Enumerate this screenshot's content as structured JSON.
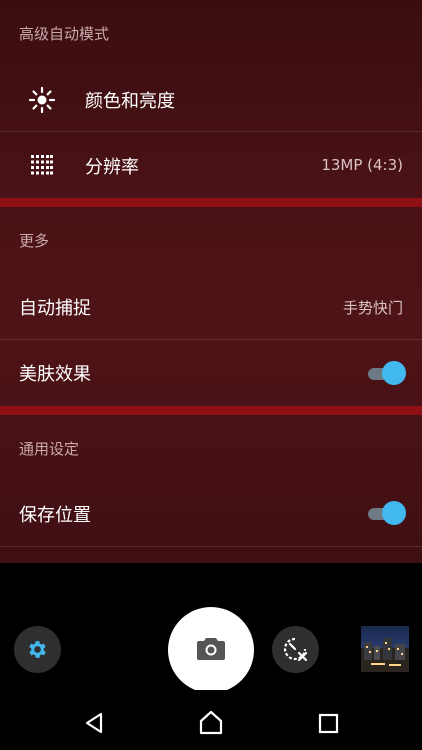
{
  "sections": {
    "advanced_auto": "高级自动模式",
    "more": "更多",
    "general": "通用设定"
  },
  "items": {
    "color_brightness": {
      "label": "颜色和亮度",
      "icon": "brightness-icon"
    },
    "resolution": {
      "label": "分辨率",
      "value": "13MP (4:3)",
      "icon": "grid-dots-icon"
    },
    "auto_capture": {
      "label": "自动捕捉",
      "value": "手势快门"
    },
    "beauty_effect": {
      "label": "美肤效果",
      "on": true
    },
    "save_location": {
      "label": "保存位置",
      "on": true
    }
  },
  "colors": {
    "accent": "#41b9ee",
    "band": "#8e1115",
    "background": "#4a1216"
  },
  "camera_controls": {
    "settings_icon": "gear-icon",
    "shutter_icon": "camera-icon",
    "timer_icon": "timer-off-icon",
    "gallery_icon": "gallery-thumbnail"
  },
  "nav": {
    "back_icon": "back-triangle-icon",
    "home_icon": "home-icon",
    "recents_icon": "recents-square-icon"
  }
}
